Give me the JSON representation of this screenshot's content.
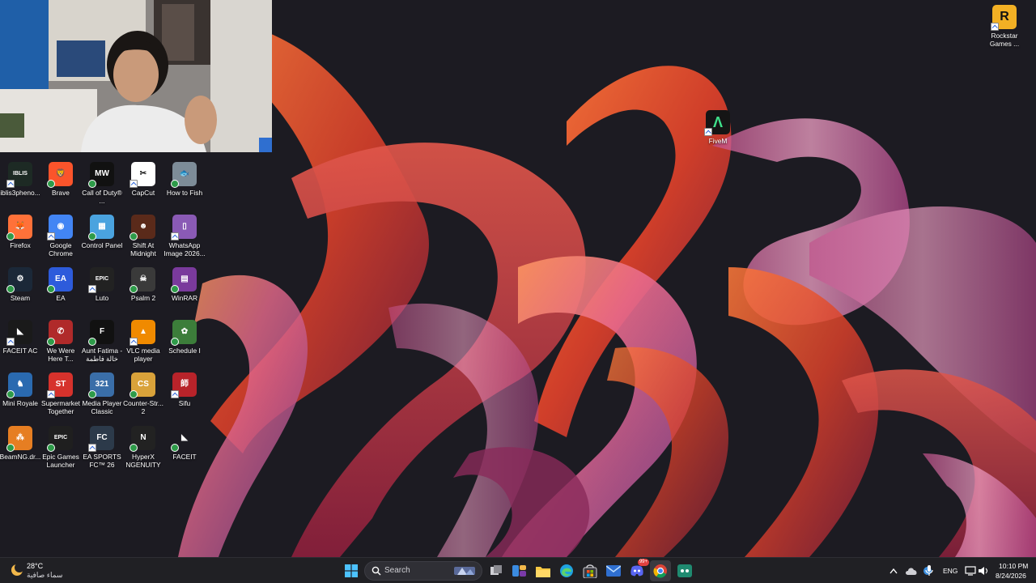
{
  "desktop": {
    "left_icons": [
      {
        "label": "iblis3pheno...",
        "icon": "iblis-game-icon",
        "bg": "#1d2a24",
        "glyph": "IBLIS"
      },
      {
        "label": "Brave",
        "icon": "brave-icon",
        "bg": "#fb542b",
        "glyph": "🦁"
      },
      {
        "label": "Call of Duty® ...",
        "icon": "call-of-duty-icon",
        "bg": "#111111",
        "glyph": "MW"
      },
      {
        "label": "CapCut",
        "icon": "capcut-icon",
        "bg": "#ffffff",
        "glyph": "✂"
      },
      {
        "label": "How to Fish",
        "icon": "how-to-fish-icon",
        "bg": "#7d8c98",
        "glyph": "🐟"
      },
      {
        "label": "Firefox",
        "icon": "firefox-icon",
        "bg": "#ff7139",
        "glyph": "🦊"
      },
      {
        "label": "Google Chrome",
        "icon": "chrome-icon",
        "bg": "#4285f4",
        "glyph": "◉"
      },
      {
        "label": "Control Panel",
        "icon": "control-panel-icon",
        "bg": "#4aa3df",
        "glyph": "▦"
      },
      {
        "label": "Shift At Midnight",
        "icon": "shift-at-midnight-icon",
        "bg": "#5a2a1a",
        "glyph": "☻"
      },
      {
        "label": "WhatsApp Image 2026...",
        "icon": "image-file-icon",
        "bg": "#8a5ab5",
        "glyph": "▯"
      },
      {
        "label": "Steam",
        "icon": "steam-icon",
        "bg": "#1b2838",
        "glyph": "⚙"
      },
      {
        "label": "EA",
        "icon": "ea-icon",
        "bg": "#2d5bdb",
        "glyph": "EA"
      },
      {
        "label": "Luto",
        "icon": "epic-games-icon",
        "bg": "#222222",
        "glyph": "EPIC"
      },
      {
        "label": "Psalm 2",
        "icon": "psalm-2-icon",
        "bg": "#3a3a3a",
        "glyph": "☠"
      },
      {
        "label": "WinRAR",
        "icon": "winrar-icon",
        "bg": "#7a3a9c",
        "glyph": "▤"
      },
      {
        "label": "FACEIT AC",
        "icon": "faceit-ac-icon",
        "bg": "#1a1a1a",
        "glyph": "◣"
      },
      {
        "label": "We Were Here T...",
        "icon": "we-were-here-icon",
        "bg": "#b02a2a",
        "glyph": "✆"
      },
      {
        "label": "Aunt Fatima - خالة فاطمة",
        "icon": "aunt-fatima-icon",
        "bg": "#111111",
        "glyph": "F"
      },
      {
        "label": "VLC media player",
        "icon": "vlc-icon",
        "bg": "#f08a00",
        "glyph": "▲"
      },
      {
        "label": "Schedule I",
        "icon": "schedule-i-icon",
        "bg": "#3c7d3a",
        "glyph": "✿"
      },
      {
        "label": "Mini Royale",
        "icon": "mini-royale-icon",
        "bg": "#2a6ab0",
        "glyph": "♞"
      },
      {
        "label": "Supermarket Together",
        "icon": "supermarket-together-icon",
        "bg": "#d6322c",
        "glyph": "ST"
      },
      {
        "label": "Media Player Classic",
        "icon": "media-player-classic-icon",
        "bg": "#3a6ea8",
        "glyph": "321"
      },
      {
        "label": "Counter-Str... 2",
        "icon": "counter-strike-icon",
        "bg": "#d9a23a",
        "glyph": "CS"
      },
      {
        "label": "Sifu",
        "icon": "sifu-icon",
        "bg": "#b8232a",
        "glyph": "師"
      },
      {
        "label": "BeamNG.dr...",
        "icon": "beamng-icon",
        "bg": "#e67e22",
        "glyph": "⁂"
      },
      {
        "label": "Epic Games Launcher",
        "icon": "epic-games-launcher-icon",
        "bg": "#1f1f1f",
        "glyph": "EPIC"
      },
      {
        "label": "EA SPORTS FC™ 26",
        "icon": "ea-sports-fc-icon",
        "bg": "#2c3a4a",
        "glyph": "FC"
      },
      {
        "label": "HyperX NGENUITY",
        "icon": "hyperx-ngenuity-icon",
        "bg": "#222222",
        "glyph": "N"
      },
      {
        "label": "FACEIT",
        "icon": "faceit-icon",
        "bg": "transparent",
        "glyph": "◣"
      }
    ],
    "rockstar": {
      "label": "Rockstar Games ...",
      "icon": "rockstar-games-icon",
      "bg": "#f2b024",
      "glyph": "R"
    },
    "fivem": {
      "label": "FiveM",
      "icon": "fivem-icon",
      "bg": "#151515",
      "glyph": "Λ"
    }
  },
  "taskbar": {
    "weather": {
      "temp": "28°C",
      "desc": "سماء صافية",
      "icon": "weather-moon-icon"
    },
    "search_placeholder": "Search",
    "apps": [
      {
        "name": "start-button",
        "icon": "windows-logo-icon"
      },
      {
        "name": "task-view-button",
        "icon": "task-view-icon"
      },
      {
        "name": "widgets-button",
        "icon": "widgets-icon"
      },
      {
        "name": "file-explorer-button",
        "icon": "folder-icon"
      },
      {
        "name": "edge-button",
        "icon": "edge-icon"
      },
      {
        "name": "store-button",
        "icon": "store-icon"
      },
      {
        "name": "mail-button",
        "icon": "mail-icon"
      },
      {
        "name": "discord-button",
        "icon": "discord-icon",
        "badge": "99+"
      },
      {
        "name": "chrome-button",
        "icon": "chrome-icon"
      },
      {
        "name": "terminal-button",
        "icon": "app-icon"
      }
    ],
    "tray": {
      "language": "ENG",
      "time": "10:10 PM",
      "date": "8/24/2026"
    }
  },
  "colors": {
    "taskbar_bg": "#202024",
    "wallpaper_bg": "#1c1b22"
  }
}
